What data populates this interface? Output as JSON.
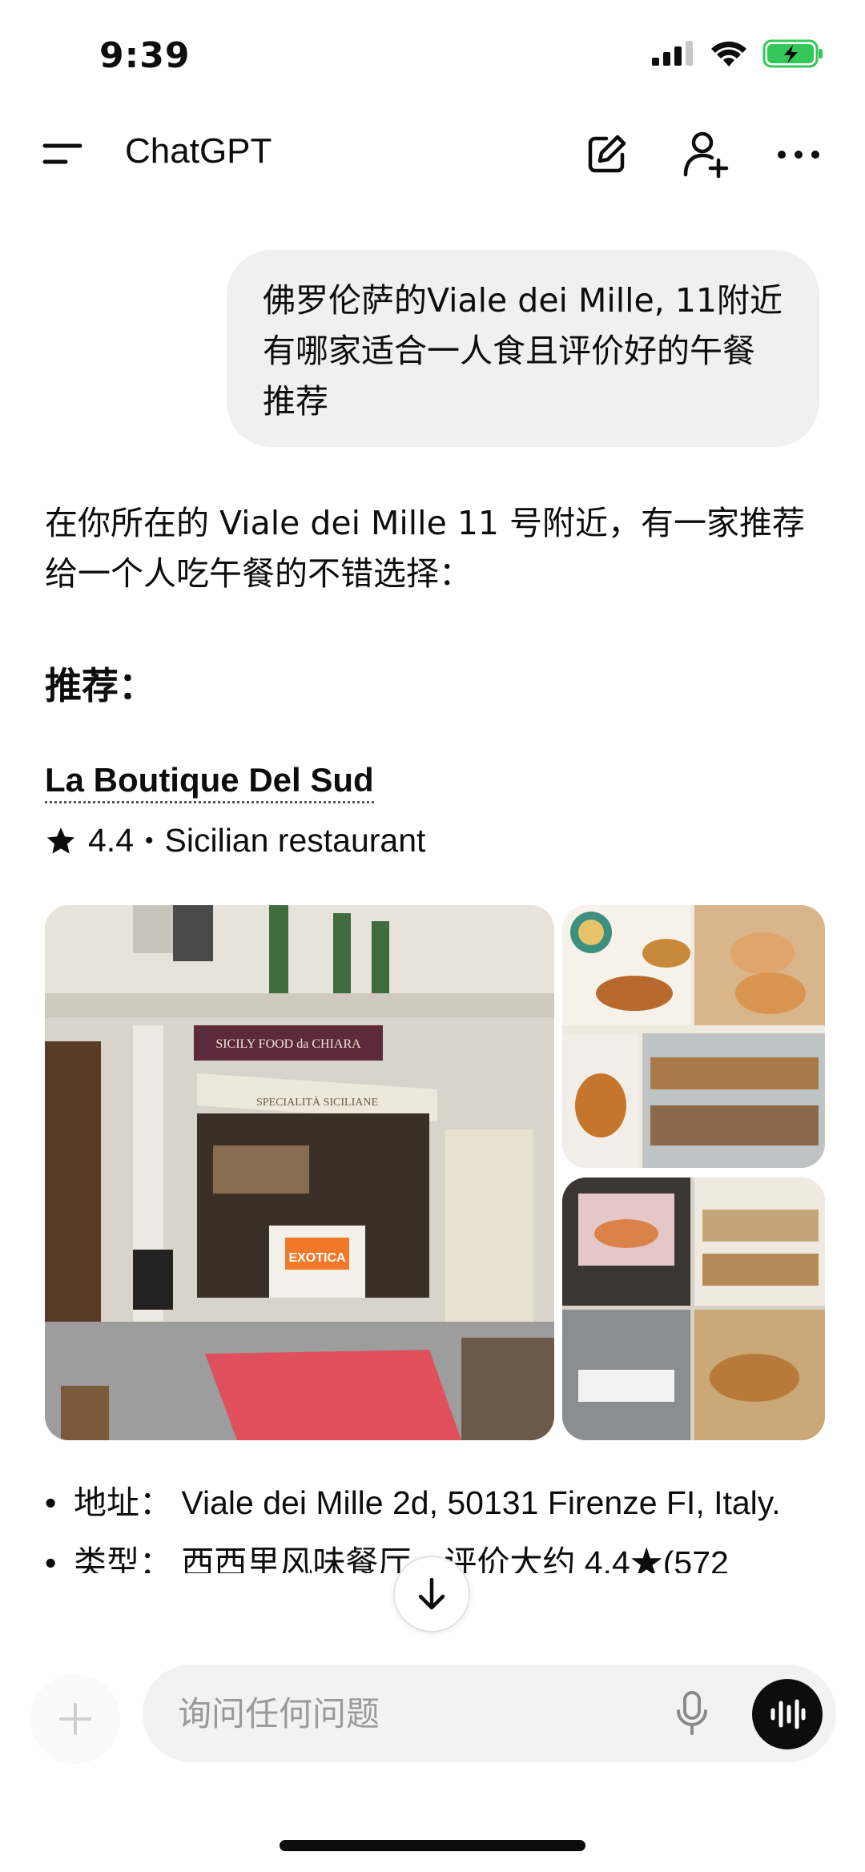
{
  "status_bar": {
    "time": "9:39",
    "icons": [
      "cellular-signal-icon",
      "wifi-icon",
      "battery-charging-icon"
    ],
    "battery_color": "#34c759"
  },
  "header": {
    "title": "ChatGPT",
    "icons": [
      "menu-icon",
      "new-chat-icon",
      "add-person-icon",
      "more-icon"
    ]
  },
  "user_message": {
    "text": "佛罗伦萨的Viale dei Mille, 11附近有哪家适合一人食且评价好的午餐推荐"
  },
  "assistant": {
    "intro": "在你所在的 Viale dei Mille 11 号附近，有一家推荐给一个人吃午餐的不错选择：",
    "section_title": "推荐：",
    "place": {
      "name": "La Boutique Del Sud",
      "rating": "4.4",
      "separator": "•",
      "category": "Sicilian restaurant",
      "star_icon": "star-icon"
    },
    "photos": {
      "main_sign": "SICILY FOOD da CHIARA",
      "main_awning": "SPECIALITÀ SICILIANE",
      "main_cart_label": "EXOTICA"
    },
    "bullets": [
      "地址： Viale dei Mille 2d, 50131 Firenze FI, Italy.",
      "类型： 西西里风味餐厅，评价大约 4.4★(572"
    ]
  },
  "composer": {
    "placeholder": "询问任何问题",
    "plus_icon": "plus-icon",
    "mic_icon": "microphone-icon",
    "voice_icon": "voice-mode-icon"
  },
  "colors": {
    "bubble": "#f0f0f0",
    "text": "#0d0d0d",
    "placeholder": "#9a9a9a",
    "awning_red": "#e0505c"
  }
}
